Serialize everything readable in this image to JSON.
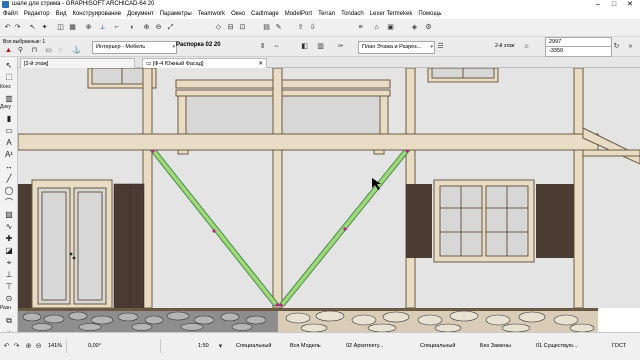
{
  "window": {
    "title": "шале для стрима - GRAPHISOFT ARCHICAD-64 20",
    "controls": [
      "–",
      "□",
      "✕"
    ]
  },
  "menu": [
    "Файл",
    "Редактор",
    "Вид",
    "Конструирование",
    "Документ",
    "Параметры",
    "Teamwork",
    "Окно",
    "CadImage",
    "ModelPort",
    "Terran",
    "Tondach",
    "Lexer Termekek",
    "Помощь"
  ],
  "toolbar": {
    "selected_label": "Все выбранные: 1",
    "favorites_combo": "Интерьер - Мебель",
    "element_name": "Распорка 02 20",
    "layer_combo": "План Этажа и Разрез...",
    "story_label": "2-й этаж",
    "coord_top": "2997",
    "coord_bottom": "-3350"
  },
  "tabs": [
    {
      "label": "[2-й этаж]",
      "active": false
    },
    {
      "label": "[Ф-4 Южный Фасад]",
      "active": true
    }
  ],
  "toolbox": {
    "sections": [
      "Конс",
      "Доку",
      "Разн"
    ],
    "tools": [
      "arrow-select-icon",
      "marquee-icon",
      "wall-icon",
      "column-icon",
      "beam-icon",
      "slab-icon",
      "roof-icon",
      "text-icon",
      "label-icon",
      "dimension-icon",
      "line-icon",
      "arc-icon",
      "polyline-icon",
      "fill-icon",
      "spline-icon",
      "hotspot-icon",
      "figure-icon",
      "camera-icon",
      "section-icon",
      "elevation-icon",
      "detail-icon"
    ]
  },
  "statusbar": {
    "zoom": "141%",
    "angle": "0,00°",
    "scale": "1:50",
    "structure": "Специальный",
    "model": "Вся Модель",
    "architecture": "02 Архитекту...",
    "pen_set": "Специальный",
    "markers": "Без Замены",
    "existing": "01 Существую...",
    "standard": "ГОСТ"
  },
  "colors": {
    "timber": "#e9dcc4",
    "timber_outline": "#6b5a43",
    "plaster": "#e4e4e4",
    "brace_green": "#9fd77b",
    "node_magenta": "#c0208a",
    "shutter": "#4a3c32",
    "glass": "#d7d7d7",
    "stone": "#8e8e8e"
  }
}
